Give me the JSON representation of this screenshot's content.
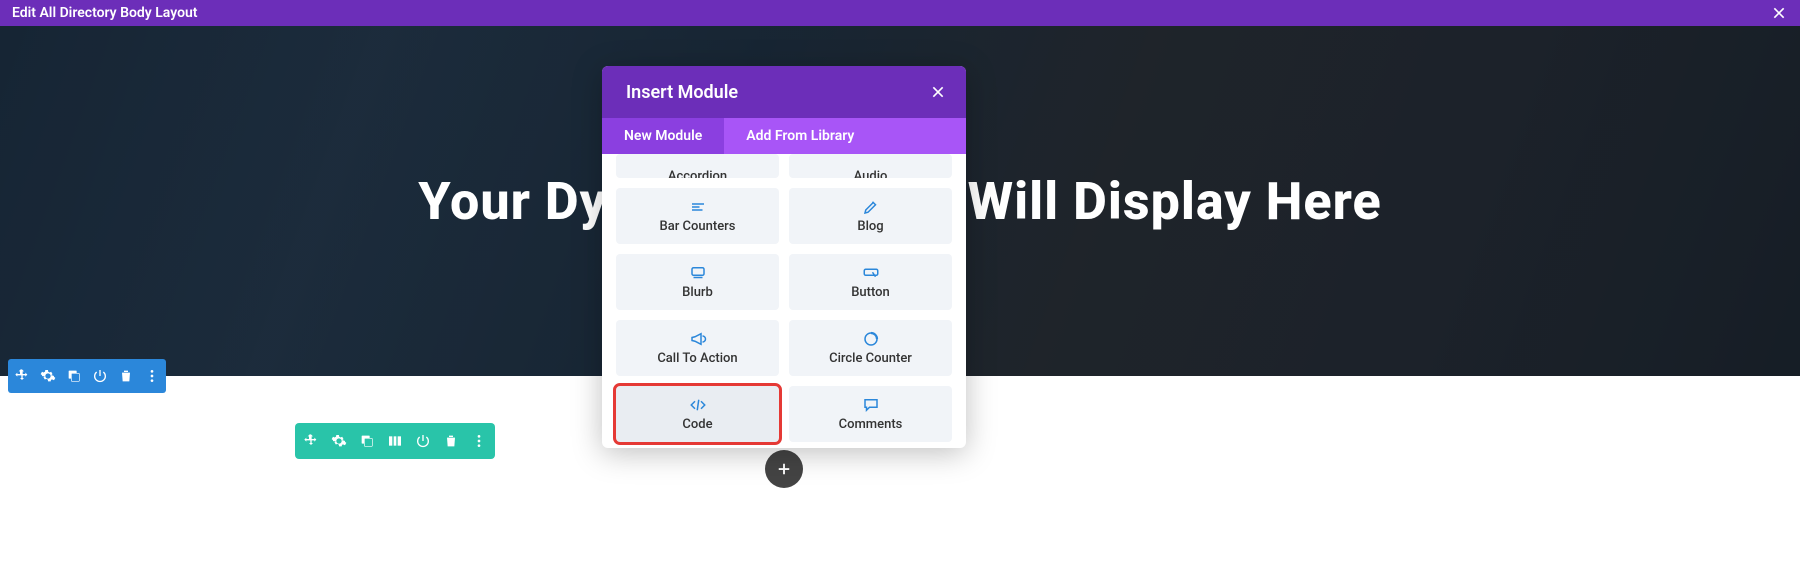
{
  "topBar": {
    "title": "Edit All Directory Body Layout"
  },
  "hero": {
    "title": "Your Dynamic Subject Will Display Here"
  },
  "modal": {
    "title": "Insert Module",
    "tabs": {
      "new": "New Module",
      "library": "Add From Library"
    },
    "modules": {
      "accordion": "Accordion",
      "audio": "Audio",
      "barCounters": "Bar Counters",
      "blog": "Blog",
      "blurb": "Blurb",
      "button": "Button",
      "callToAction": "Call To Action",
      "circleCounter": "Circle Counter",
      "code": "Code",
      "comments": "Comments"
    }
  }
}
